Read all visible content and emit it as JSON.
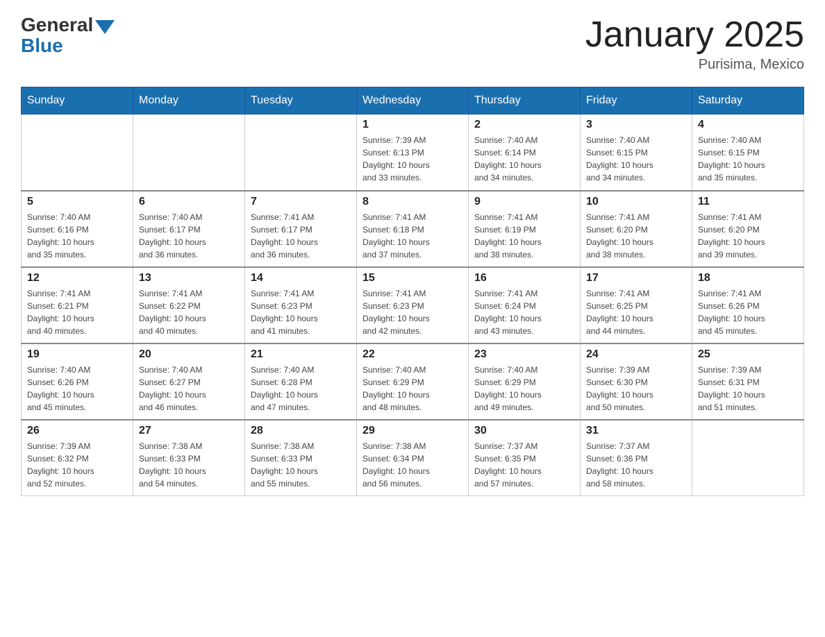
{
  "header": {
    "logo_general": "General",
    "logo_blue": "Blue",
    "month_title": "January 2025",
    "location": "Purisima, Mexico"
  },
  "weekdays": [
    "Sunday",
    "Monday",
    "Tuesday",
    "Wednesday",
    "Thursday",
    "Friday",
    "Saturday"
  ],
  "weeks": [
    [
      {
        "day": "",
        "info": ""
      },
      {
        "day": "",
        "info": ""
      },
      {
        "day": "",
        "info": ""
      },
      {
        "day": "1",
        "info": "Sunrise: 7:39 AM\nSunset: 6:13 PM\nDaylight: 10 hours\nand 33 minutes."
      },
      {
        "day": "2",
        "info": "Sunrise: 7:40 AM\nSunset: 6:14 PM\nDaylight: 10 hours\nand 34 minutes."
      },
      {
        "day": "3",
        "info": "Sunrise: 7:40 AM\nSunset: 6:15 PM\nDaylight: 10 hours\nand 34 minutes."
      },
      {
        "day": "4",
        "info": "Sunrise: 7:40 AM\nSunset: 6:15 PM\nDaylight: 10 hours\nand 35 minutes."
      }
    ],
    [
      {
        "day": "5",
        "info": "Sunrise: 7:40 AM\nSunset: 6:16 PM\nDaylight: 10 hours\nand 35 minutes."
      },
      {
        "day": "6",
        "info": "Sunrise: 7:40 AM\nSunset: 6:17 PM\nDaylight: 10 hours\nand 36 minutes."
      },
      {
        "day": "7",
        "info": "Sunrise: 7:41 AM\nSunset: 6:17 PM\nDaylight: 10 hours\nand 36 minutes."
      },
      {
        "day": "8",
        "info": "Sunrise: 7:41 AM\nSunset: 6:18 PM\nDaylight: 10 hours\nand 37 minutes."
      },
      {
        "day": "9",
        "info": "Sunrise: 7:41 AM\nSunset: 6:19 PM\nDaylight: 10 hours\nand 38 minutes."
      },
      {
        "day": "10",
        "info": "Sunrise: 7:41 AM\nSunset: 6:20 PM\nDaylight: 10 hours\nand 38 minutes."
      },
      {
        "day": "11",
        "info": "Sunrise: 7:41 AM\nSunset: 6:20 PM\nDaylight: 10 hours\nand 39 minutes."
      }
    ],
    [
      {
        "day": "12",
        "info": "Sunrise: 7:41 AM\nSunset: 6:21 PM\nDaylight: 10 hours\nand 40 minutes."
      },
      {
        "day": "13",
        "info": "Sunrise: 7:41 AM\nSunset: 6:22 PM\nDaylight: 10 hours\nand 40 minutes."
      },
      {
        "day": "14",
        "info": "Sunrise: 7:41 AM\nSunset: 6:23 PM\nDaylight: 10 hours\nand 41 minutes."
      },
      {
        "day": "15",
        "info": "Sunrise: 7:41 AM\nSunset: 6:23 PM\nDaylight: 10 hours\nand 42 minutes."
      },
      {
        "day": "16",
        "info": "Sunrise: 7:41 AM\nSunset: 6:24 PM\nDaylight: 10 hours\nand 43 minutes."
      },
      {
        "day": "17",
        "info": "Sunrise: 7:41 AM\nSunset: 6:25 PM\nDaylight: 10 hours\nand 44 minutes."
      },
      {
        "day": "18",
        "info": "Sunrise: 7:41 AM\nSunset: 6:26 PM\nDaylight: 10 hours\nand 45 minutes."
      }
    ],
    [
      {
        "day": "19",
        "info": "Sunrise: 7:40 AM\nSunset: 6:26 PM\nDaylight: 10 hours\nand 45 minutes."
      },
      {
        "day": "20",
        "info": "Sunrise: 7:40 AM\nSunset: 6:27 PM\nDaylight: 10 hours\nand 46 minutes."
      },
      {
        "day": "21",
        "info": "Sunrise: 7:40 AM\nSunset: 6:28 PM\nDaylight: 10 hours\nand 47 minutes."
      },
      {
        "day": "22",
        "info": "Sunrise: 7:40 AM\nSunset: 6:29 PM\nDaylight: 10 hours\nand 48 minutes."
      },
      {
        "day": "23",
        "info": "Sunrise: 7:40 AM\nSunset: 6:29 PM\nDaylight: 10 hours\nand 49 minutes."
      },
      {
        "day": "24",
        "info": "Sunrise: 7:39 AM\nSunset: 6:30 PM\nDaylight: 10 hours\nand 50 minutes."
      },
      {
        "day": "25",
        "info": "Sunrise: 7:39 AM\nSunset: 6:31 PM\nDaylight: 10 hours\nand 51 minutes."
      }
    ],
    [
      {
        "day": "26",
        "info": "Sunrise: 7:39 AM\nSunset: 6:32 PM\nDaylight: 10 hours\nand 52 minutes."
      },
      {
        "day": "27",
        "info": "Sunrise: 7:38 AM\nSunset: 6:33 PM\nDaylight: 10 hours\nand 54 minutes."
      },
      {
        "day": "28",
        "info": "Sunrise: 7:38 AM\nSunset: 6:33 PM\nDaylight: 10 hours\nand 55 minutes."
      },
      {
        "day": "29",
        "info": "Sunrise: 7:38 AM\nSunset: 6:34 PM\nDaylight: 10 hours\nand 56 minutes."
      },
      {
        "day": "30",
        "info": "Sunrise: 7:37 AM\nSunset: 6:35 PM\nDaylight: 10 hours\nand 57 minutes."
      },
      {
        "day": "31",
        "info": "Sunrise: 7:37 AM\nSunset: 6:36 PM\nDaylight: 10 hours\nand 58 minutes."
      },
      {
        "day": "",
        "info": ""
      }
    ]
  ]
}
